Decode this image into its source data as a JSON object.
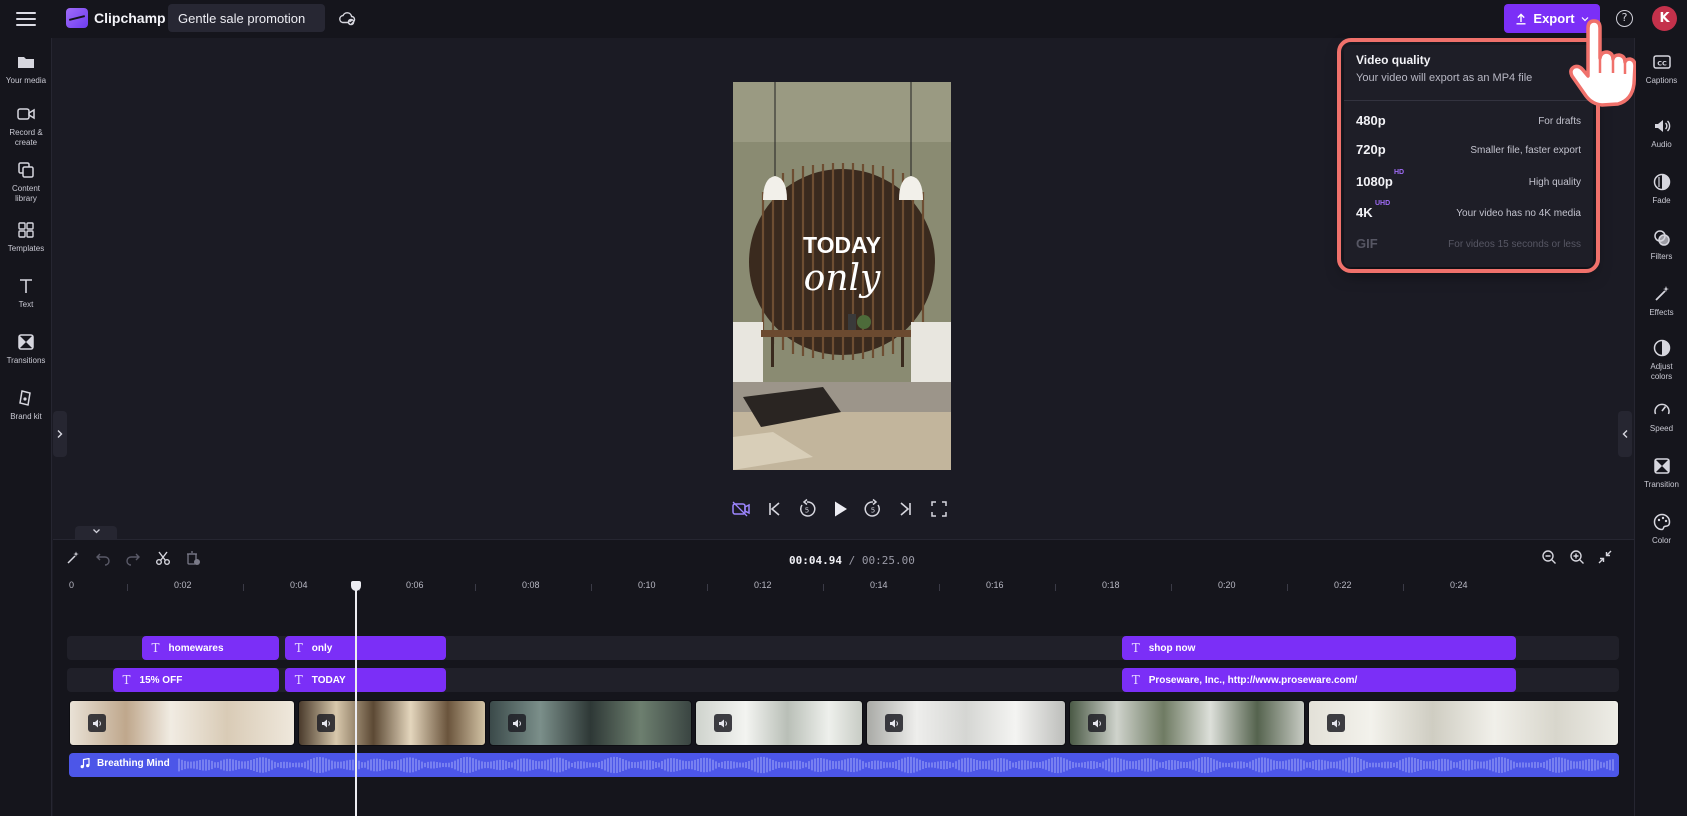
{
  "app": {
    "name": "Clipchamp",
    "project_title": "Gentle sale promotion",
    "user_initial": "K"
  },
  "toolbar": {
    "export_label": "Export",
    "help_label": "?"
  },
  "left_sidebar": {
    "items": [
      {
        "label": "Your media",
        "icon": "folder-icon"
      },
      {
        "label": "Record & create",
        "icon": "camera-icon"
      },
      {
        "label": "Content library",
        "icon": "library-icon"
      },
      {
        "label": "Templates",
        "icon": "grid-icon"
      },
      {
        "label": "Text",
        "icon": "text-icon"
      },
      {
        "label": "Transitions",
        "icon": "transition-icon"
      },
      {
        "label": "Brand kit",
        "icon": "brand-icon"
      }
    ]
  },
  "right_sidebar": {
    "items": [
      {
        "label": "Captions",
        "icon": "cc-icon"
      },
      {
        "label": "Audio",
        "icon": "speaker-icon"
      },
      {
        "label": "Fade",
        "icon": "fade-icon"
      },
      {
        "label": "Filters",
        "icon": "filters-icon"
      },
      {
        "label": "Effects",
        "icon": "wand-icon"
      },
      {
        "label": "Adjust colors",
        "icon": "contrast-icon"
      },
      {
        "label": "Speed",
        "icon": "speedometer-icon"
      },
      {
        "label": "Transition",
        "icon": "transition-icon"
      },
      {
        "label": "Color",
        "icon": "palette-icon"
      }
    ]
  },
  "preview": {
    "line1": "TODAY",
    "line2": "only"
  },
  "export_menu": {
    "title": "Video quality",
    "subtitle": "Your video will export as an MP4 file",
    "options": [
      {
        "name": "480p",
        "badge": "",
        "desc": "For drafts",
        "enabled": true
      },
      {
        "name": "720p",
        "badge": "",
        "desc": "Smaller file, faster export",
        "enabled": true
      },
      {
        "name": "1080p",
        "badge": "HD",
        "desc": "High quality",
        "enabled": true
      },
      {
        "name": "4K",
        "badge": "UHD",
        "desc": "Your video has no 4K media",
        "enabled": true
      },
      {
        "name": "GIF",
        "badge": "",
        "desc": "For videos 15 seconds or less",
        "enabled": false
      }
    ]
  },
  "timeline": {
    "current_time": "00:04.94",
    "total_time": "/ 00:25.00",
    "ruler_labels": [
      "0",
      "0:02",
      "0:04",
      "0:06",
      "0:08",
      "0:10",
      "0:12",
      "0:14",
      "0:16",
      "0:18",
      "0:20",
      "0:22",
      "0:24"
    ],
    "text_clips_row1": [
      {
        "label": "homewares",
        "start": 1.25,
        "end": 3.62
      },
      {
        "label": "only",
        "start": 3.72,
        "end": 6.5
      },
      {
        "label": "shop now",
        "start": 18.15,
        "end": 24.95
      }
    ],
    "text_clips_row2": [
      {
        "label": "15% OFF",
        "start": 0.75,
        "end": 3.62
      },
      {
        "label": "TODAY",
        "start": 3.72,
        "end": 6.5
      },
      {
        "label": "Proseware, Inc., http://www.proseware.com/",
        "start": 18.15,
        "end": 24.95
      }
    ],
    "audio_clip": {
      "label": "Breathing Mind"
    },
    "playhead_seconds": 4.94
  }
}
